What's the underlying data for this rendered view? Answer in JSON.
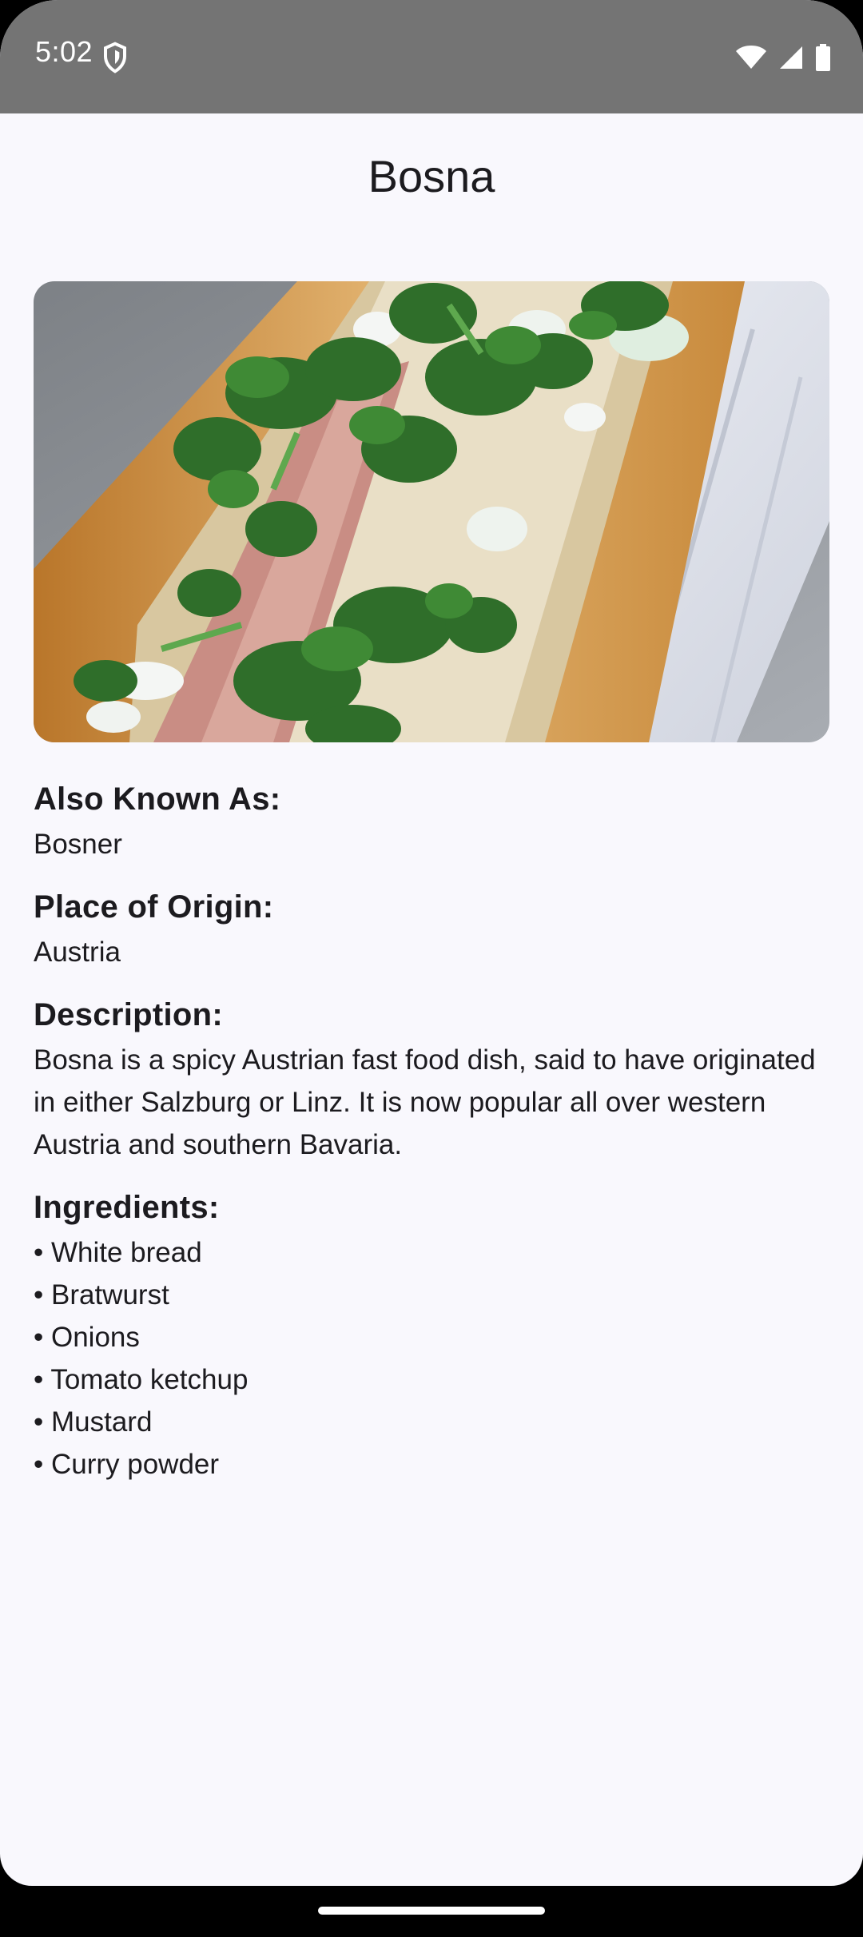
{
  "status_bar": {
    "time": "5:02",
    "icons": [
      "shield-icon",
      "wifi-icon",
      "cellular-signal-icon",
      "battery-icon"
    ]
  },
  "app": {
    "title": "Bosna"
  },
  "hero_image": {
    "description_icon": "food-photo-bosna"
  },
  "details": {
    "also_known_as_label": "Also Known As:",
    "also_known_as_value": "Bosner",
    "origin_label": "Place of Origin:",
    "origin_value": "Austria",
    "description_label": "Description:",
    "description_value": "Bosna is a spicy Austrian fast food dish, said to have originated in either Salzburg or Linz. It is now popular all over western Austria and southern Bavaria.",
    "ingredients_label": "Ingredients:",
    "ingredients": [
      "• White bread",
      "• Bratwurst",
      "• Onions",
      "• Tomato ketchup",
      "• Mustard",
      "• Curry powder"
    ]
  },
  "colors": {
    "status_bar": "#747474",
    "background": "#f9f8fd",
    "text": "#1c1b1f"
  }
}
